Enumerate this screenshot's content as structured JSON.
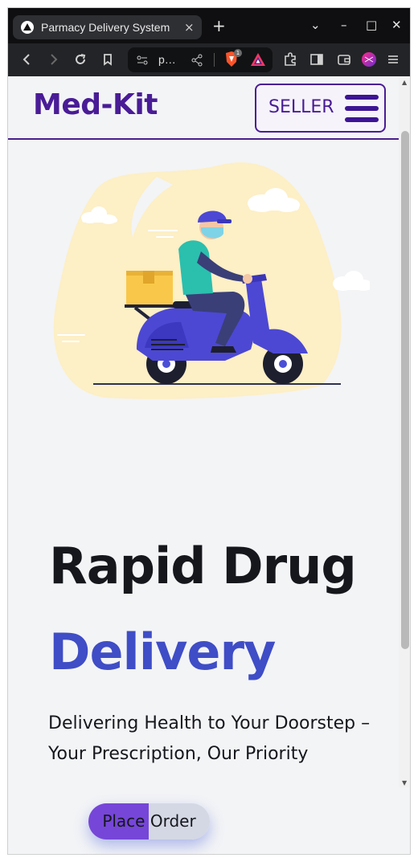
{
  "browser": {
    "tab_title": "Parmacy Delivery System",
    "tab_close": "×",
    "new_tab": "+",
    "url": "p…",
    "shields_badge": "1",
    "window_controls": {
      "dropdown": "⌄",
      "minimize": "–",
      "maximize": "□",
      "close": "✕"
    }
  },
  "header": {
    "brand": "Med-Kit",
    "seller_label": "SELLER"
  },
  "hero": {
    "title_line1": "Rapid Drug",
    "title_line2": "Delivery",
    "subtitle": "Delivering Health to Your Doorstep – Your Prescription, Our Priority",
    "button_label": "Place Order"
  },
  "colors": {
    "brand": "#4a1c96",
    "accent": "#3f4dc6",
    "button_left": "#7646d8",
    "button_right": "#d4d8e4",
    "blob": "#fdefc6"
  },
  "icons": [
    "back-icon",
    "forward-icon",
    "reload-icon",
    "bookmark-icon",
    "site-settings-icon",
    "share-icon",
    "brave-shields-icon",
    "rewards-icon",
    "extensions-icon",
    "sidebar-icon",
    "wallet-icon",
    "profile-icon",
    "menu-icon",
    "hamburger-icon"
  ]
}
